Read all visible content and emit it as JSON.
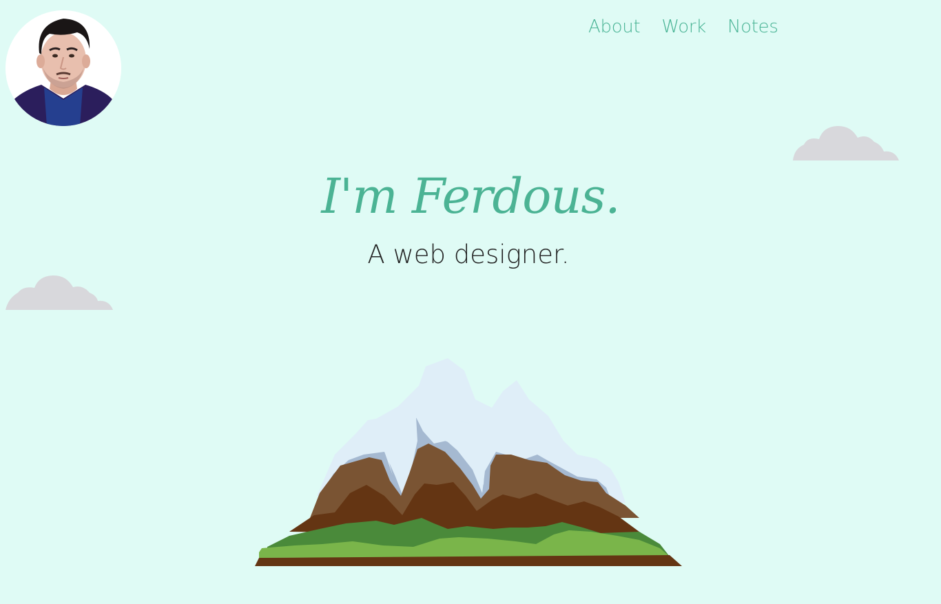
{
  "profile": {
    "avatar_alt": "Profile photo"
  },
  "nav": {
    "items": [
      {
        "label": "About"
      },
      {
        "label": "Work"
      },
      {
        "label": "Notes"
      }
    ]
  },
  "hero": {
    "title": "I'm Ferdous.",
    "subtitle": "A web designer."
  },
  "colors": {
    "background": "#dffbf5",
    "accent": "#4bb394",
    "cloud": "#d8d8dc",
    "text": "#222222"
  },
  "icons": {
    "cloud": "cloud-icon",
    "mountain": "mountain-illustration"
  }
}
